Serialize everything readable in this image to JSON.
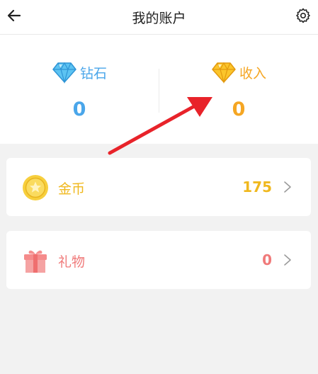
{
  "header": {
    "title": "我的账户",
    "back_icon": "arrow-left-icon",
    "settings_icon": "gear-icon"
  },
  "stats": [
    {
      "label": "钻石",
      "value": "0",
      "icon": "blue-diamond-icon",
      "color": "#4aa6ea"
    },
    {
      "label": "收入",
      "value": "0",
      "icon": "gold-diamond-icon",
      "color": "#f5a623"
    }
  ],
  "cards": [
    {
      "label": "金币",
      "value": "175",
      "icon": "coin-icon",
      "color": "#f0b81e"
    },
    {
      "label": "礼物",
      "value": "0",
      "icon": "gift-icon",
      "color": "#f07a7a"
    }
  ],
  "annotation": {
    "type": "red-arrow",
    "color": "#e8232a"
  }
}
